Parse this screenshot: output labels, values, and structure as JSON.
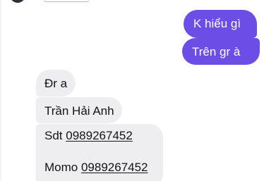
{
  "top": {
    "reaction_glyph": "♡"
  },
  "messages_sent": [
    {
      "text": "K hiểu gì"
    },
    {
      "text": "Trên gr à"
    }
  ],
  "messages_received": [
    {
      "text": "Đr a"
    },
    {
      "text": "Trần Hải Anh"
    }
  ],
  "contact_card": {
    "sdt_label": "Sdt",
    "sdt_number": "0989267452",
    "momo_label": "Momo",
    "momo_number": "0989267452"
  },
  "colors": {
    "sent_bubble": "#6c4de6",
    "received_bubble": "#eeeef1"
  }
}
